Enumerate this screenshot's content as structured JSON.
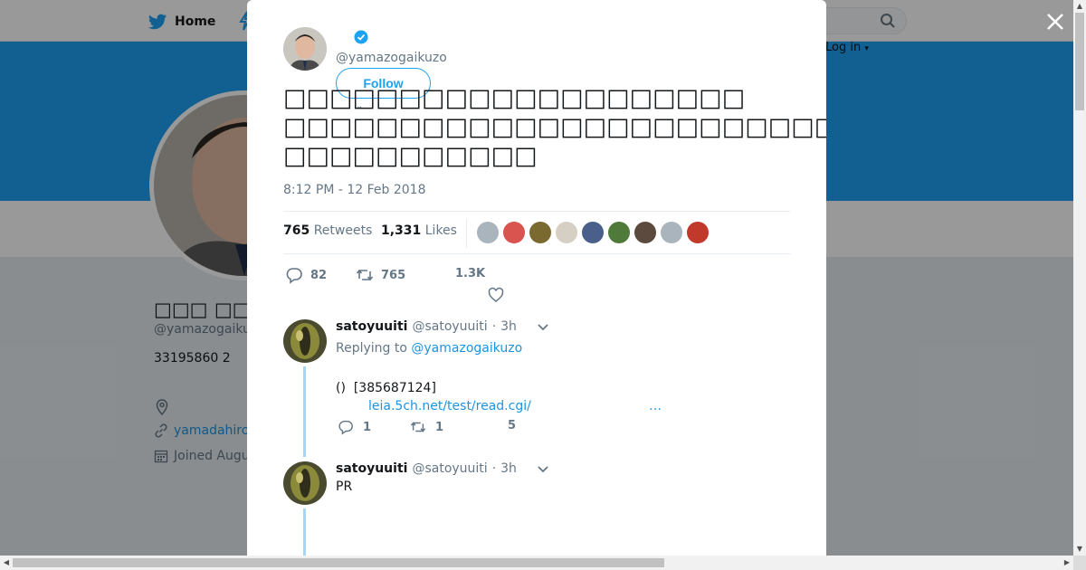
{
  "nav": {
    "home_label": "Home",
    "login_label": "Log in"
  },
  "profile": {
    "name": "□□□ □□□□□□",
    "handle": "@yamazogaiku",
    "bio": "33195860 2",
    "link": "yamadahiro",
    "joined": "Joined Augu"
  },
  "tweet": {
    "author_handle": "@yamazogaikuzo",
    "follow_label": "Follow",
    "text": "□□□□□□□□□□□□□□□□□□□□\n□□□□□□□□□□□□□□□□□□□□□□□□□□□□□□□□□□□□□□□□□□□□□□□□□□□□□□□□□PR□□\n□□□□□□□□□□□",
    "timestamp": "8:12 PM - 12 Feb 2018",
    "retweets_count": "765",
    "retweets_label": "Retweets",
    "likes_count": "1,331",
    "likes_label": "Likes",
    "liker_colors": [
      "#aab4bd",
      "#d9534f",
      "#7a6a2f",
      "#d6d0c4",
      "#4a5f8a",
      "#4f7a3a",
      "#5c4a3e",
      "#aab4bd",
      "#c0392b"
    ],
    "actions": {
      "replies": "82",
      "retweets": "765",
      "likes": "1.3K"
    }
  },
  "replies": [
    {
      "name": "satoyuuiti",
      "handle": "@satoyuuiti",
      "sep": "·",
      "time": "3h",
      "replying_label": "Replying to",
      "replying_to": "@yamazogaikuzo",
      "body": "()  [385687124]",
      "link": "leia.5ch.net/test/read.cgi/",
      "ellipsis": "…",
      "reply_count": "1",
      "retweet_count": "1",
      "like_count": "5"
    },
    {
      "name": "satoyuuiti",
      "handle": "@satoyuuiti",
      "sep": "·",
      "time": "3h",
      "body": "PR"
    }
  ]
}
